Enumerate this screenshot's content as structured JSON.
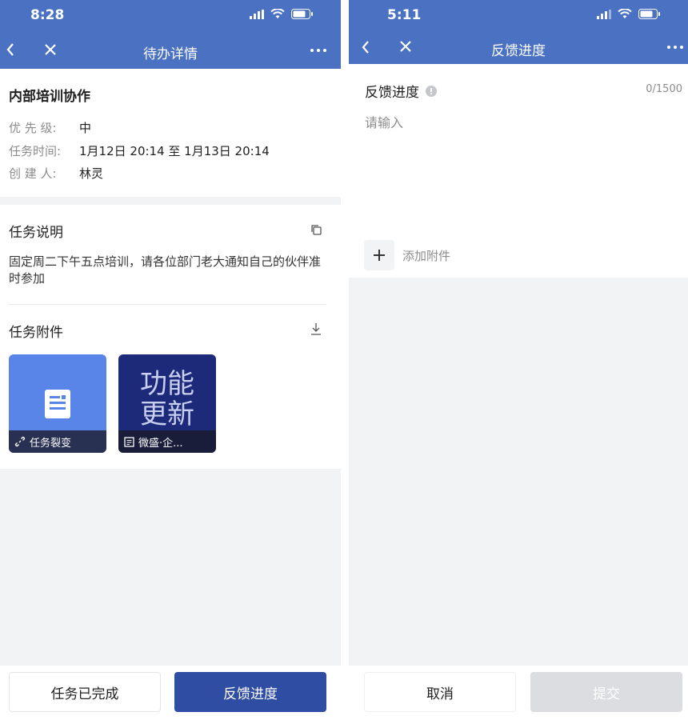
{
  "left": {
    "status": {
      "time": "8:28"
    },
    "nav": {
      "title": "待办详情"
    },
    "task": {
      "title": "内部培训协作",
      "priority_label": "优 先 级:",
      "priority_value": "中",
      "time_label": "任务时间:",
      "time_value": "1月12日 20:14 至 1月13日 20:14",
      "creator_label": "创 建 人:",
      "creator_value": "林灵"
    },
    "description": {
      "title": "任务说明",
      "text": "固定周二下午五点培训，请各位部门老大通知自己的伙伴准时参加"
    },
    "attachments": {
      "title": "任务附件",
      "items": [
        {
          "caption": "任务裂变",
          "icon": "link-icon"
        },
        {
          "caption": "微盛·企...",
          "icon": "article-icon",
          "cover_text": "功能更新"
        }
      ]
    },
    "actions": {
      "done": "任务已完成",
      "feedback": "反馈进度"
    }
  },
  "right": {
    "status": {
      "time": "5:11"
    },
    "nav": {
      "title": "反馈进度"
    },
    "form": {
      "label": "反馈进度",
      "counter": "0/1500",
      "placeholder": "请输入",
      "add_attachment": "添加附件"
    },
    "actions": {
      "cancel": "取消",
      "submit": "提交"
    }
  },
  "colors": {
    "header_blue": "#4b72c2",
    "primary_button": "#2f4da3",
    "page_bg": "#f2f3f5",
    "disabled_button": "#dcdde0"
  }
}
